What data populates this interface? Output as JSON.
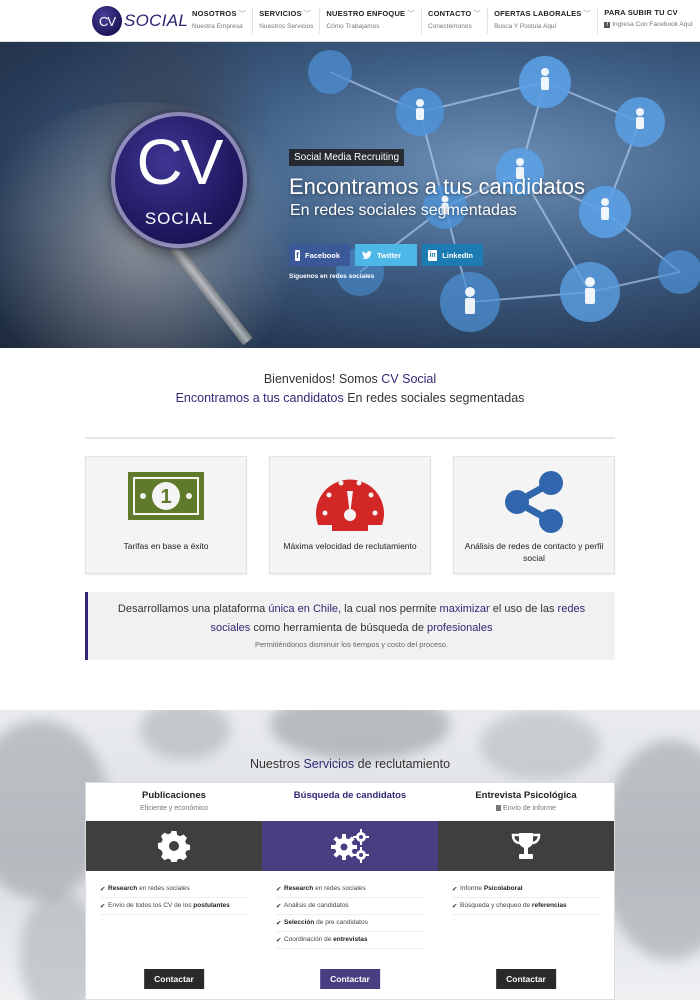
{
  "header": {
    "logo": {
      "cv": "CV",
      "social": "SOCIAL"
    },
    "nav": [
      {
        "title": "NOSOTROS",
        "sub": "Nuestra Empresa",
        "chevron": true
      },
      {
        "title": "SERVICIOS",
        "sub": "Nuestros Servicios",
        "chevron": true
      },
      {
        "title": "NUESTRO ENFOQUE",
        "sub": "Cómo Trabajamos",
        "chevron": true
      },
      {
        "title": "CONTACTO",
        "sub": "Conectémonos",
        "chevron": true
      },
      {
        "title": "OFERTAS LABORALES",
        "sub": "Busca Y Postula Aquí",
        "chevron": true
      },
      {
        "title": "PARA SUBIR TU CV",
        "sub": "Ingresa Con Facebook Aquí",
        "chevron": false,
        "icon": "facebook-icon"
      }
    ]
  },
  "hero": {
    "logo_cv": "CV",
    "logo_social": "SOCIAL",
    "badge": "Social Media Recruiting",
    "title": "Encontramos a tus candidatos",
    "subtitle": "En redes sociales segmentadas",
    "buttons": {
      "facebook": "Facebook",
      "twitter": "Twitter",
      "linkedin": "LinkedIn"
    },
    "follow": "Síguenos en redes sociales"
  },
  "welcome": {
    "line1_prefix": "Bienvenidos! Somos ",
    "line1_accent": "CV Social",
    "line2_accent": "Encontramos a tus candidatos",
    "line2_suffix": " En redes sociales segmentadas"
  },
  "features": [
    {
      "label": "Tarifas en base a éxito",
      "icon": "money-bill-icon",
      "color": "#5f7a2a"
    },
    {
      "label": "Máxima velocidad de reclutamiento",
      "icon": "speedometer-icon",
      "color": "#d32727"
    },
    {
      "label": "Análisis de redes de contacto y perfil social",
      "icon": "share-icon",
      "color": "#2f66ad"
    }
  ],
  "info": {
    "t1": "Desarrollamos una plataforma ",
    "a1": "única en Chile",
    "t2": ", la cual nos permite ",
    "a2": "maximizar",
    "t3": " el uso de las ",
    "a3": "redes sociales",
    "t4": " como herramienta de búsqueda de ",
    "a4": "profesionales",
    "sub": "Permitiéndonos disminuir los tiempos y costo del proceso."
  },
  "services": {
    "title_prefix": "Nuestros ",
    "title_accent": "Servicios",
    "title_suffix": " de reclutamiento",
    "cols": [
      {
        "name": "Publicaciones",
        "note": "Eficiente y económico",
        "icon": "gear-icon",
        "items": [
          {
            "bold": "Research",
            "text": " en redes sociales",
            "bold_first": true
          },
          {
            "text": "Envío de todos los CV de los ",
            "bold": "postulantes",
            "bold_first": false
          }
        ],
        "button": "Contactar"
      },
      {
        "name": "Búsqueda de candidatos",
        "note": "",
        "icon": "gears-icon",
        "items": [
          {
            "bold": "Research",
            "text": " en redes sociales",
            "bold_first": true
          },
          {
            "text": "Análisis de candidatos",
            "bold": "",
            "bold_first": false
          },
          {
            "bold": "Selección",
            "text": " de pre candidatos",
            "bold_first": true
          },
          {
            "text": "Coordinación de ",
            "bold": "entrevistas",
            "bold_first": false
          }
        ],
        "button": "Contactar"
      },
      {
        "name": "Entrevista Psicológica",
        "note": "Envío de informe",
        "icon": "trophy-icon",
        "items": [
          {
            "text": "Informe ",
            "bold": "Psicolaboral",
            "bold_first": false
          },
          {
            "text": "Búsqueda y chequeo de ",
            "bold": "referencias",
            "bold_first": false
          }
        ],
        "button": "Contactar"
      }
    ]
  }
}
